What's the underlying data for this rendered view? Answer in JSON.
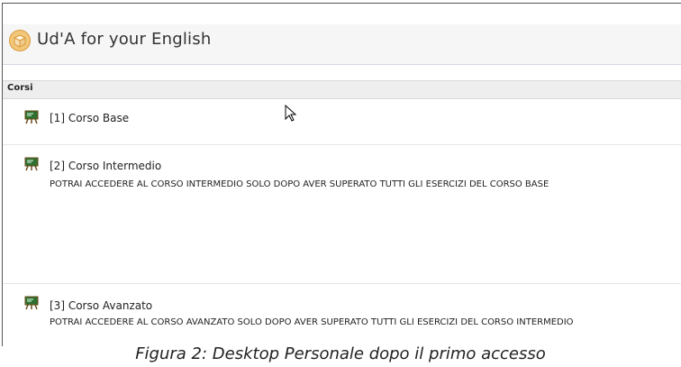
{
  "header": {
    "title": "Ud'A for your English",
    "icon": "box-icon"
  },
  "section": {
    "label": "Corsi"
  },
  "courses": [
    {
      "title": "[1] Corso Base",
      "note": ""
    },
    {
      "title": "[2] Corso Intermedio",
      "note": "POTRAI ACCEDERE AL CORSO INTERMEDIO SOLO DOPO AVER SUPERATO TUTTI GLI ESERCIZI DEL CORSO BASE"
    },
    {
      "title": "[3] Corso Avanzato",
      "note": "POTRAI ACCEDERE AL CORSO AVANZATO SOLO DOPO AVER SUPERATO TUTTI GLI ESERCIZI DEL CORSO INTERMEDIO"
    }
  ],
  "caption": "Figura 2: Desktop Personale dopo il primo accesso",
  "colors": {
    "header_bg": "#f6f6f7",
    "section_bg": "#eeeeef"
  }
}
